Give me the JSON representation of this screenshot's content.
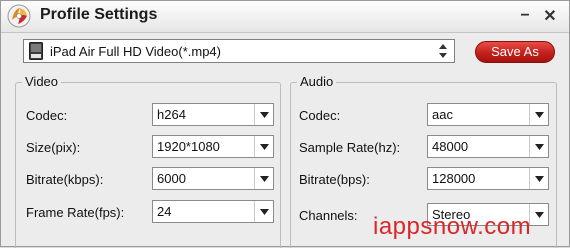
{
  "window": {
    "title": "Profile Settings",
    "minimize_label": "−",
    "close_label": "✕"
  },
  "profile": {
    "selected": "iPad Air Full HD Video(*.mp4)",
    "icon": "mp4-file-icon"
  },
  "save_as_label": "Save As",
  "video": {
    "title": "Video",
    "fields": [
      {
        "label": "Codec:",
        "value": "h264"
      },
      {
        "label": "Size(pix):",
        "value": "1920*1080"
      },
      {
        "label": "Bitrate(kbps):",
        "value": "6000"
      },
      {
        "label": "Frame Rate(fps):",
        "value": "24"
      }
    ]
  },
  "audio": {
    "title": "Audio",
    "fields": [
      {
        "label": "Codec:",
        "value": "aac"
      },
      {
        "label": "Sample Rate(hz):",
        "value": "48000"
      },
      {
        "label": "Bitrate(bps):",
        "value": "128000"
      },
      {
        "label": "Channels:",
        "value": "Stereo"
      }
    ]
  },
  "watermark": "iappsnow.com",
  "colors": {
    "accent": "#c3201c",
    "watermark": "#d8282a"
  }
}
